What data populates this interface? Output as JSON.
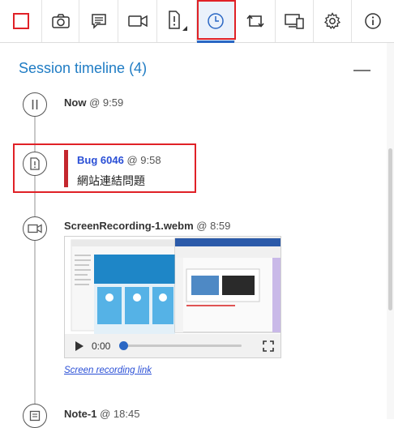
{
  "toolbar": {
    "buttons": [
      {
        "name": "stop-session-icon",
        "label": "Stop session"
      },
      {
        "name": "camera-icon",
        "label": "Capture screenshot"
      },
      {
        "name": "note-icon",
        "label": "Add note"
      },
      {
        "name": "video-icon",
        "label": "Record screen"
      },
      {
        "name": "bug-icon",
        "label": "Create bug"
      },
      {
        "name": "clock-icon",
        "label": "Timeline"
      },
      {
        "name": "loop-icon",
        "label": "Session"
      },
      {
        "name": "device-icon",
        "label": "Devices"
      },
      {
        "name": "gear-icon",
        "label": "Settings"
      },
      {
        "name": "info-icon",
        "label": "About"
      }
    ],
    "selected": "clock-icon",
    "accent": "#2b67c4",
    "stop_color": "#e02127"
  },
  "timeline": {
    "title": "Session timeline (4)",
    "entries": [
      {
        "kind": "pause",
        "name": "Now",
        "at": "@ 9:59"
      },
      {
        "kind": "bug",
        "name": "Bug 6046",
        "at": "@ 9:58",
        "text": "網站連結問題"
      },
      {
        "kind": "recording",
        "name": "ScreenRecording-1.webm",
        "at": "@ 8:59",
        "time": "0:00",
        "link": "Screen recording link"
      },
      {
        "kind": "note",
        "name": "Note-1",
        "at": "@ 18:45"
      }
    ]
  },
  "colors": {
    "title": "#1f7cc4",
    "link": "#2a4fd6",
    "bug": "#c4272e",
    "highlight": "#e02127"
  }
}
